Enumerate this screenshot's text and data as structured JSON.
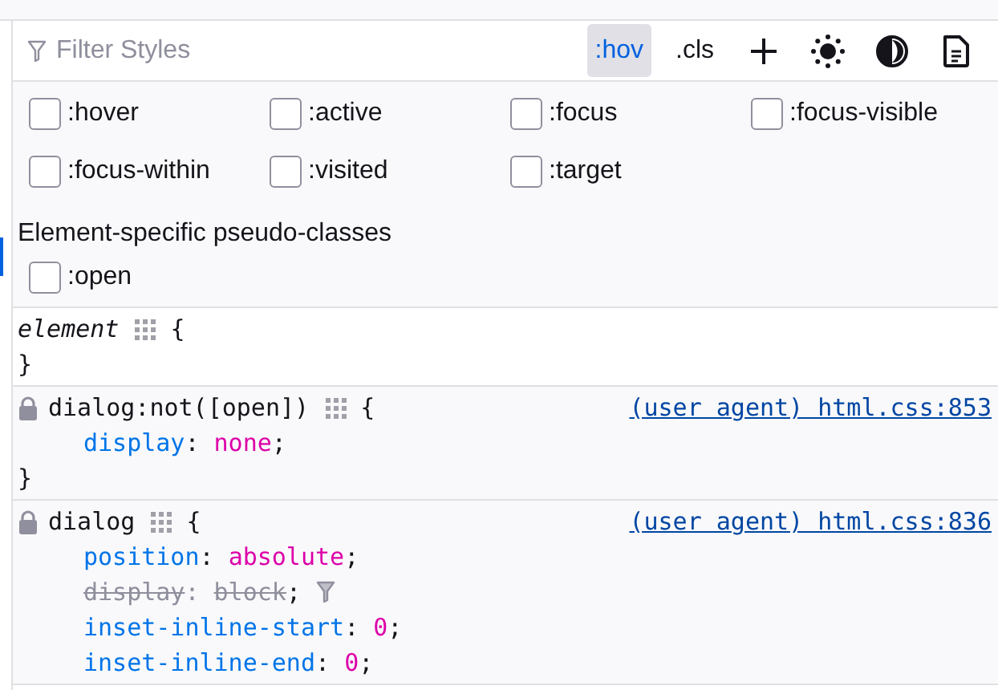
{
  "toolbar": {
    "filter": {
      "placeholder": "Filter Styles"
    },
    "buttons": [
      {
        "kind": "text",
        "label": ":hov",
        "selected": true
      },
      {
        "kind": "text",
        "label": ".cls",
        "selected": false
      },
      {
        "kind": "add",
        "selected": false
      },
      {
        "kind": "light",
        "selected": false
      },
      {
        "kind": "contrast",
        "selected": false
      },
      {
        "kind": "document",
        "selected": false
      }
    ]
  },
  "pseudo_classes": [
    {
      "label": ":hover",
      "checked": false
    },
    {
      "label": ":active",
      "checked": false
    },
    {
      "label": ":focus",
      "checked": false
    },
    {
      "label": ":focus-visible",
      "checked": false
    },
    {
      "label": ":focus-within",
      "checked": false
    },
    {
      "label": ":visited",
      "checked": false
    },
    {
      "label": ":target",
      "checked": false
    }
  ],
  "element_specific": {
    "heading": "Element-specific pseudo-classes",
    "items": [
      {
        "label": ":open",
        "checked": false
      }
    ]
  },
  "rules": [
    {
      "selector": "element",
      "user_agent": false,
      "open_brace": "{",
      "close_brace": "}"
    },
    {
      "selector": "dialog:not([open])",
      "user_agent": true,
      "source": "(user agent) html.css:853",
      "declarations": [
        {
          "name": "display",
          "colon": ":",
          "value": "none",
          "semicolon": ";",
          "overridden": false
        }
      ],
      "open_brace": "{",
      "close_brace": "}"
    },
    {
      "selector": "dialog",
      "user_agent": true,
      "source": "(user agent) html.css:836",
      "declarations": [
        {
          "name": "position",
          "colon": ":",
          "value": "absolute",
          "semicolon": ";",
          "overridden": false
        },
        {
          "name": "display",
          "colon": ":",
          "value": "block",
          "semicolon": ";",
          "overridden": true
        },
        {
          "name": "inset-inline-start",
          "colon": ":",
          "value": "0",
          "semicolon": ";",
          "overridden": false
        },
        {
          "name": "inset-inline-end",
          "colon": ":",
          "value": "0",
          "semicolon": ";",
          "overridden": false
        }
      ],
      "open_brace": "{"
    }
  ]
}
